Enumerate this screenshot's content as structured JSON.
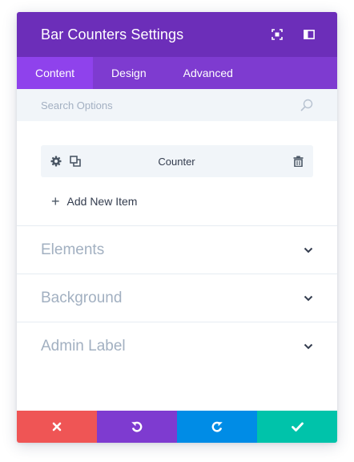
{
  "header": {
    "title": "Bar Counters Settings",
    "icons": [
      "expand-icon",
      "sidebar-toggle-icon"
    ],
    "background": "#6c2eb9"
  },
  "tabs": [
    {
      "label": "Content",
      "active": true
    },
    {
      "label": "Design",
      "active": false
    },
    {
      "label": "Advanced",
      "active": false
    }
  ],
  "search": {
    "placeholder": "Search Options",
    "icon": "search-icon"
  },
  "items": [
    {
      "label": "Counter",
      "icons": [
        "gear-icon",
        "duplicate-icon",
        "trash-icon"
      ]
    }
  ],
  "add_item_label": "Add New Item",
  "groups": [
    {
      "label": "Elements"
    },
    {
      "label": "Background"
    },
    {
      "label": "Admin Label"
    }
  ],
  "footer": {
    "buttons": [
      {
        "action": "discard",
        "icon": "close-icon",
        "color": "#ef5555"
      },
      {
        "action": "undo",
        "icon": "undo-icon",
        "color": "#7e3bd0"
      },
      {
        "action": "redo",
        "icon": "redo-icon",
        "color": "#008ce6"
      },
      {
        "action": "save",
        "icon": "check-icon",
        "color": "#00c3aa"
      }
    ]
  }
}
